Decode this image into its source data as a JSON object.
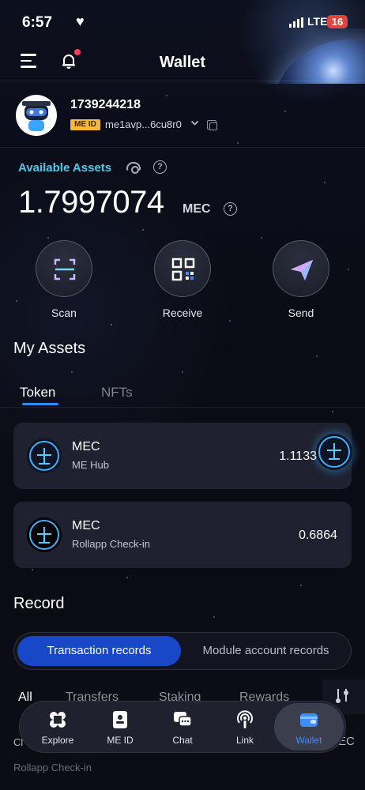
{
  "status_bar": {
    "time": "6:57",
    "network": "LTE",
    "battery": "16"
  },
  "header": {
    "title": "Wallet"
  },
  "profile": {
    "user_id": "1739244218",
    "badge": "ME ID",
    "address": "me1avp...6cu8r0"
  },
  "assets": {
    "label": "Available Assets",
    "balance": "1.7997074",
    "unit": "MEC"
  },
  "actions": [
    {
      "label": "Scan"
    },
    {
      "label": "Receive"
    },
    {
      "label": "Send"
    }
  ],
  "my_assets": {
    "title": "My Assets",
    "tabs": [
      "Token",
      "NFTs"
    ],
    "active_tab": "Token"
  },
  "tokens": [
    {
      "name": "MEC",
      "source": "ME Hub",
      "value": "1.1133"
    },
    {
      "name": "MEC",
      "source": "Rollapp Check-in",
      "value": "0.6864"
    }
  ],
  "record": {
    "title": "Record",
    "segments": [
      "Transaction records",
      "Module account records"
    ],
    "filters": [
      "All",
      "Transfers",
      "Staking",
      "Rewards"
    ],
    "partial_row_prefix": "Cl",
    "partial_row_suffix": "EC",
    "partial_row_subtitle": "Rollapp Check-in"
  },
  "nav": {
    "items": [
      {
        "label": "Explore",
        "icon": "explore-icon"
      },
      {
        "label": "ME ID",
        "icon": "id-card-icon"
      },
      {
        "label": "Chat",
        "icon": "chat-icon"
      },
      {
        "label": "Link",
        "icon": "link-icon"
      },
      {
        "label": "Wallet",
        "icon": "wallet-icon"
      }
    ],
    "active": "Wallet"
  },
  "colors": {
    "accent": "#2f8bf5",
    "available": "#52c7ea",
    "active_segment": "#1847c8",
    "wallet_active": "#3b8cff"
  }
}
